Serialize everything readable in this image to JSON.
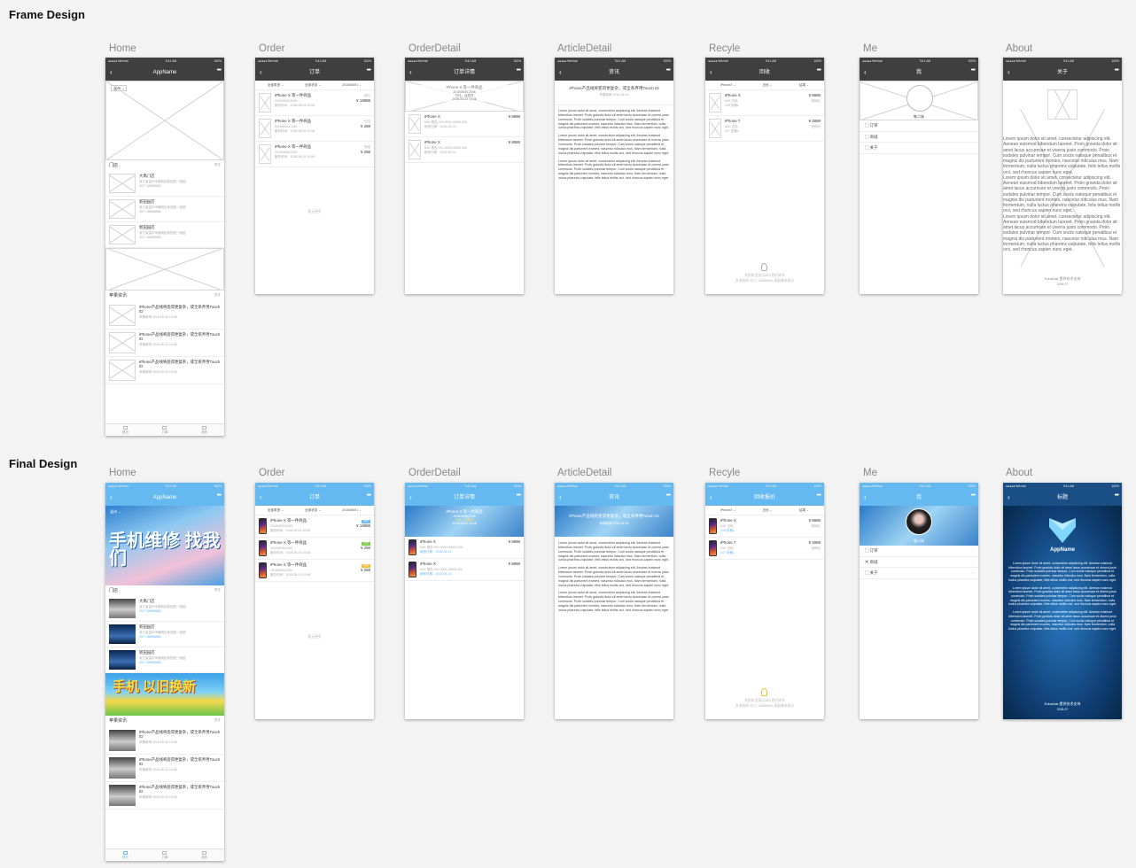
{
  "sections": {
    "frame": "Frame Design",
    "final": "Final Design"
  },
  "columns": [
    "Home",
    "Order",
    "OrderDetail",
    "ArticleDetail",
    "Recyle",
    "Me",
    "About"
  ],
  "status": {
    "carrier": "●●●●● Wechat",
    "time": "9:41 AM",
    "battery": "100%"
  },
  "nav": {
    "home": "AppName",
    "order": "订单",
    "orderdetail": "订单详情",
    "article": "资讯",
    "recyle_frame": "回收",
    "recyle_final": "回收报价",
    "me": "我",
    "about_frame": "关于",
    "about_final": "标题",
    "back": "‹",
    "more": "•••"
  },
  "home": {
    "city": "温州 ⌄",
    "stores_title": "门店",
    "more": "更多",
    "stores": [
      {
        "name": "大禹门店",
        "addr": "浙江省温州市鹿城区新田园一组团",
        "phone": "0577-88888888"
      },
      {
        "name": "新田园店",
        "addr": "浙江省温州市鹿城区新田园一组团",
        "phone": "0577-88888888"
      },
      {
        "name": "新田园店",
        "addr": "浙江省温州市鹿城区新田园一组团",
        "phone": "0577-88888888"
      }
    ],
    "news_title": "苹果资讯",
    "news": [
      {
        "title": "iPhone产品线将变得更复杂，或全系弃用Touch ID",
        "meta": "苹果新闻 2018-05-03 10:08"
      },
      {
        "title": "iPhone产品线将变得更复杂，或全系弃用Touch ID",
        "meta": "苹果新闻 2018-05-03 10:08"
      },
      {
        "title": "iPhone产品线将变得更复杂，或全系弃用Touch ID",
        "meta": "苹果新闻 2018-05-03 10:08"
      }
    ],
    "banner1": "手机维修 找我们",
    "banner2": "手机 以旧换新",
    "tabs": [
      "首页",
      "订单",
      "我的"
    ]
  },
  "order": {
    "filters": [
      "全部类型 ⌄",
      "全部状态 ⌄",
      "2018/06/01 ⌄"
    ],
    "items": [
      {
        "name": "iPhone X 等一件商品",
        "no": "2018060512345",
        "date": "服务时间：2018-05-03 10:08",
        "status": "待付",
        "price": "¥ 18888",
        "status_color": "#64b9f0"
      },
      {
        "name": "iPhone X 等一件商品",
        "no": "2018060512345",
        "date": "服务时间：2018-05-03 10:08",
        "status": "已付",
        "price": "¥ 288",
        "status_color": "#7ac943"
      },
      {
        "name": "iPhone X 等一件商品",
        "no": "2018060512345",
        "date": "服务时间：2018-05-03 10:08",
        "status": "完成",
        "price": "¥ 288",
        "status_color": "#f5b82e"
      }
    ],
    "empty": "暂无更多"
  },
  "orderdetail": {
    "head_title": "iPhone X 等一件商品",
    "head_no": "2018060512345",
    "head_status": "已付，待发货",
    "head_date": "2018-05-03 10:08",
    "items": [
      {
        "name": "iPhone X",
        "spec": "64G 银色 000-0000-00000-000",
        "date": "维修日期：2018-05-03",
        "price": "¥ 8888"
      },
      {
        "name": "iPhone X",
        "spec": "64G 银色 000-0000-00000-000",
        "date": "维修日期：2018-05-03",
        "price": "¥ 8888"
      }
    ]
  },
  "article": {
    "title": "iPhone产品线将变得更复杂，或全系弃用Touch ID",
    "meta": "苹果新闻 2018-05-03",
    "paras": [
      "Lorem ipsum dolor sit amet, consectetur adipiscing elit. Aenean euismod bibendum laoreet. Proin gravida dolor sit amet lacus accumsan et viverra justo commodo. Proin sodales pulvinar tempor. Cum sociis natoque penatibus et magnis dis parturient montes, nascetur ridiculus mus. Nam fermentum, nulla luctus pharetra vulputate, felis tellus mollis orci, sed rhoncus sapien nunc eget.",
      "Lorem ipsum dolor sit amet, consectetur adipiscing elit. Aenean euismod bibendum laoreet. Proin gravida dolor sit amet lacus accumsan et viverra justo commodo. Proin sodales pulvinar tempor. Cum sociis natoque penatibus et magnis dis parturient montes, nascetur ridiculus mus. Nam fermentum, nulla luctus pharetra vulputate, felis tellus mollis orci, sed rhoncus sapien nunc eget.",
      "Lorem ipsum dolor sit amet, consectetur adipiscing elit. Aenean euismod bibendum laoreet. Proin gravida dolor sit amet lacus accumsan et viverra justo commodo. Proin sodales pulvinar tempor. Cum sociis natoque penatibus et magnis dis parturient montes, nascetur ridiculus mus. Nam fermentum, nulla luctus pharetra vulputate, felis tellus mollis orci, sed rhoncus sapien nunc eget."
    ]
  },
  "recyle": {
    "filters": [
      "iPhoneX ⌄",
      "白色 ⌄",
      "结果 ⌄"
    ],
    "items": [
      {
        "name": "iPhone X",
        "spec": "64G 白色",
        "rate": "128 查看▸",
        "price": "¥ 8888",
        "sub": "官网价"
      },
      {
        "name": "iPhone 7",
        "spec": "64G 白色",
        "rate": "107 查看▸",
        "price": "¥ 2888",
        "sub": "官网价"
      }
    ],
    "note1": "其他机型报价请与我们联系",
    "note2": "咨询热线 0577-88888888 获取最新报价"
  },
  "me": {
    "name": "勒二妹",
    "menu": [
      "订单",
      "商城",
      "关于"
    ],
    "chev": "›"
  },
  "about": {
    "app": "AppName",
    "paras": [
      "Lorem ipsum dolor sit amet, consectetur adipiscing elit. Aenean euismod bibendum laoreet. Proin gravida dolor sit amet lacus accumsan et viverra justo commodo. Proin sodales pulvinar tempor. Cum sociis natoque penatibus et magnis dis parturient montes, nascetur ridiculus mus. Nam fermentum, nulla luctus pharetra vulputate, felis tellus mollis orci, sed rhoncus sapien nunc eget.",
      "Lorem ipsum dolor sit amet, consectetur adipiscing elit. Aenean euismod bibendum laoreet. Proin gravida dolor sit amet lacus accumsan et viverra justo commodo. Proin sodales pulvinar tempor. Cum sociis natoque penatibus et magnis dis parturient montes, nascetur ridiculus mus. Nam fermentum, nulla luctus pharetra vulputate, felis tellus mollis orci, sed rhoncus sapien nunc eget.",
      "Lorem ipsum dolor sit amet, consectetur adipiscing elit. Aenean euismod bibendum laoreet. Proin gravida dolor sit amet lacus accumsan et viverra justo commodo. Proin sodales pulvinar tempor. Cum sociis natoque penatibus et magnis dis parturient montes, nascetur ridiculus mus. Nam fermentum, nulla luctus pharetra vulputate, felis tellus mollis orci, sed rhoncus sapien nunc eget."
    ],
    "footer": "Eduwhat 提供技术支持",
    "year": "2018-07"
  }
}
